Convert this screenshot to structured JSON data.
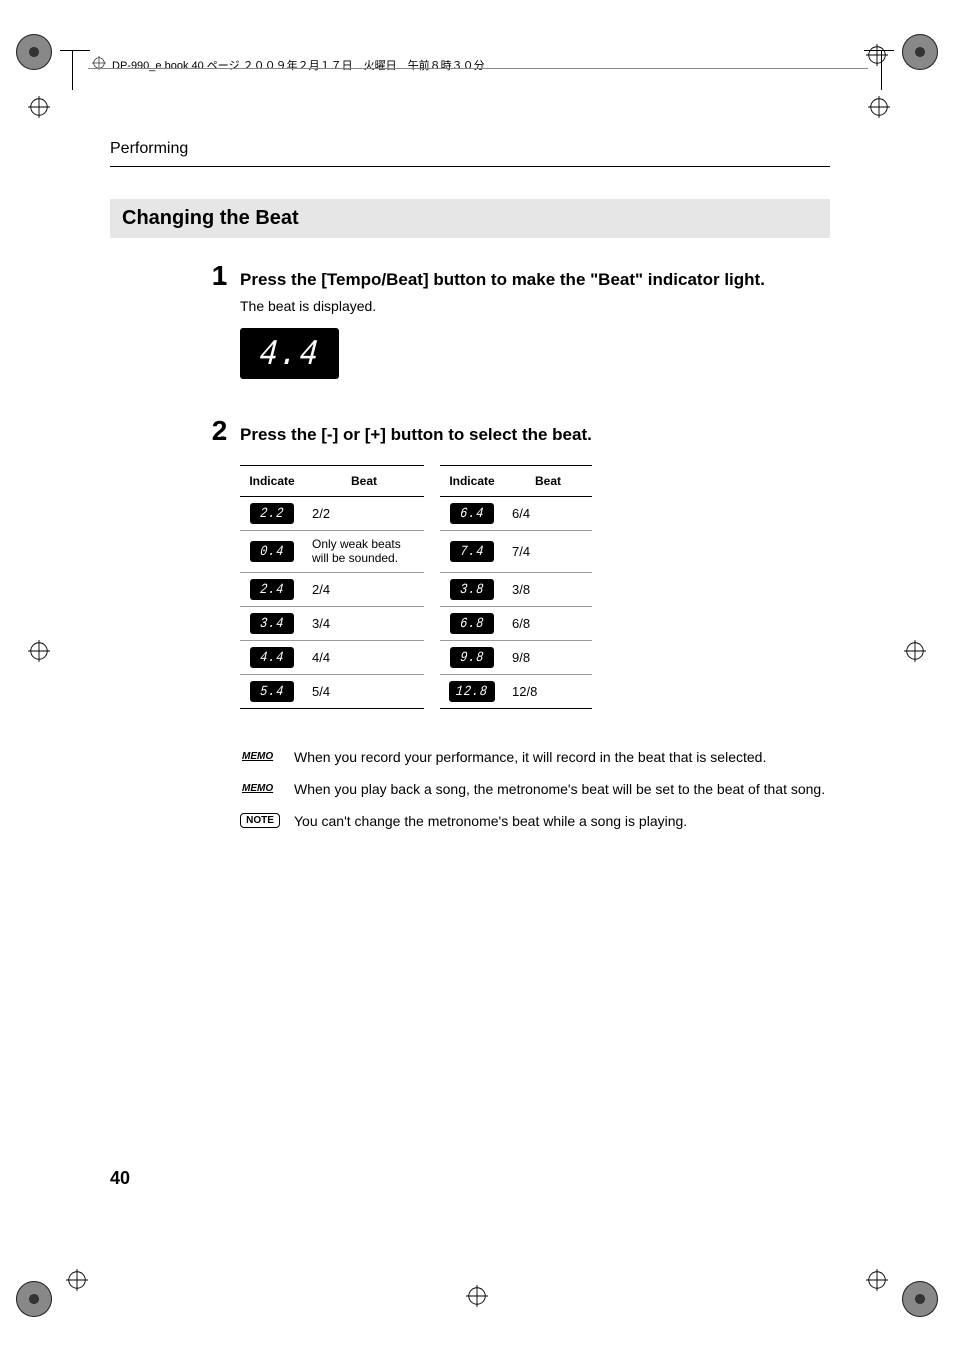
{
  "printHeader": "DP-990_e.book 40 ページ ２００９年２月１７日　火曜日　午前８時３０分",
  "breadcrumb": "Performing",
  "sectionTitle": "Changing the Beat",
  "step1": {
    "num": "1",
    "dot": ".",
    "title": "Press the [Tempo/Beat] button to make the \"Beat\" indicator light.",
    "sub": "The beat is displayed.",
    "display": "4.4"
  },
  "step2": {
    "num": "2",
    "dot": ".",
    "title": "Press the [-] or [+] button to select the beat."
  },
  "table": {
    "headers": {
      "indicate": "Indicate",
      "beat": "Beat"
    },
    "rows": [
      {
        "d1": "2.2",
        "b1": "2/2",
        "d2": "6.4",
        "b2": "6/4"
      },
      {
        "d1": "0.4",
        "b1": "Only weak beats will be sounded.",
        "d2": "7.4",
        "b2": "7/4"
      },
      {
        "d1": "2.4",
        "b1": "2/4",
        "d2": "3.8",
        "b2": "3/8"
      },
      {
        "d1": "3.4",
        "b1": "3/4",
        "d2": "6.8",
        "b2": "6/8"
      },
      {
        "d1": "4.4",
        "b1": "4/4",
        "d2": "9.8",
        "b2": "9/8"
      },
      {
        "d1": "5.4",
        "b1": "5/4",
        "d2": "12.8",
        "b2": "12/8"
      }
    ]
  },
  "memoLabel": "MEMO",
  "noteLabel": "NOTE",
  "memo1": "When you record your performance, it will record in the beat that is selected.",
  "memo2": "When you play back a song, the metronome's beat will be set to the beat of that song.",
  "note1": "You can't change the metronome's beat while a song is playing.",
  "pageNum": "40"
}
